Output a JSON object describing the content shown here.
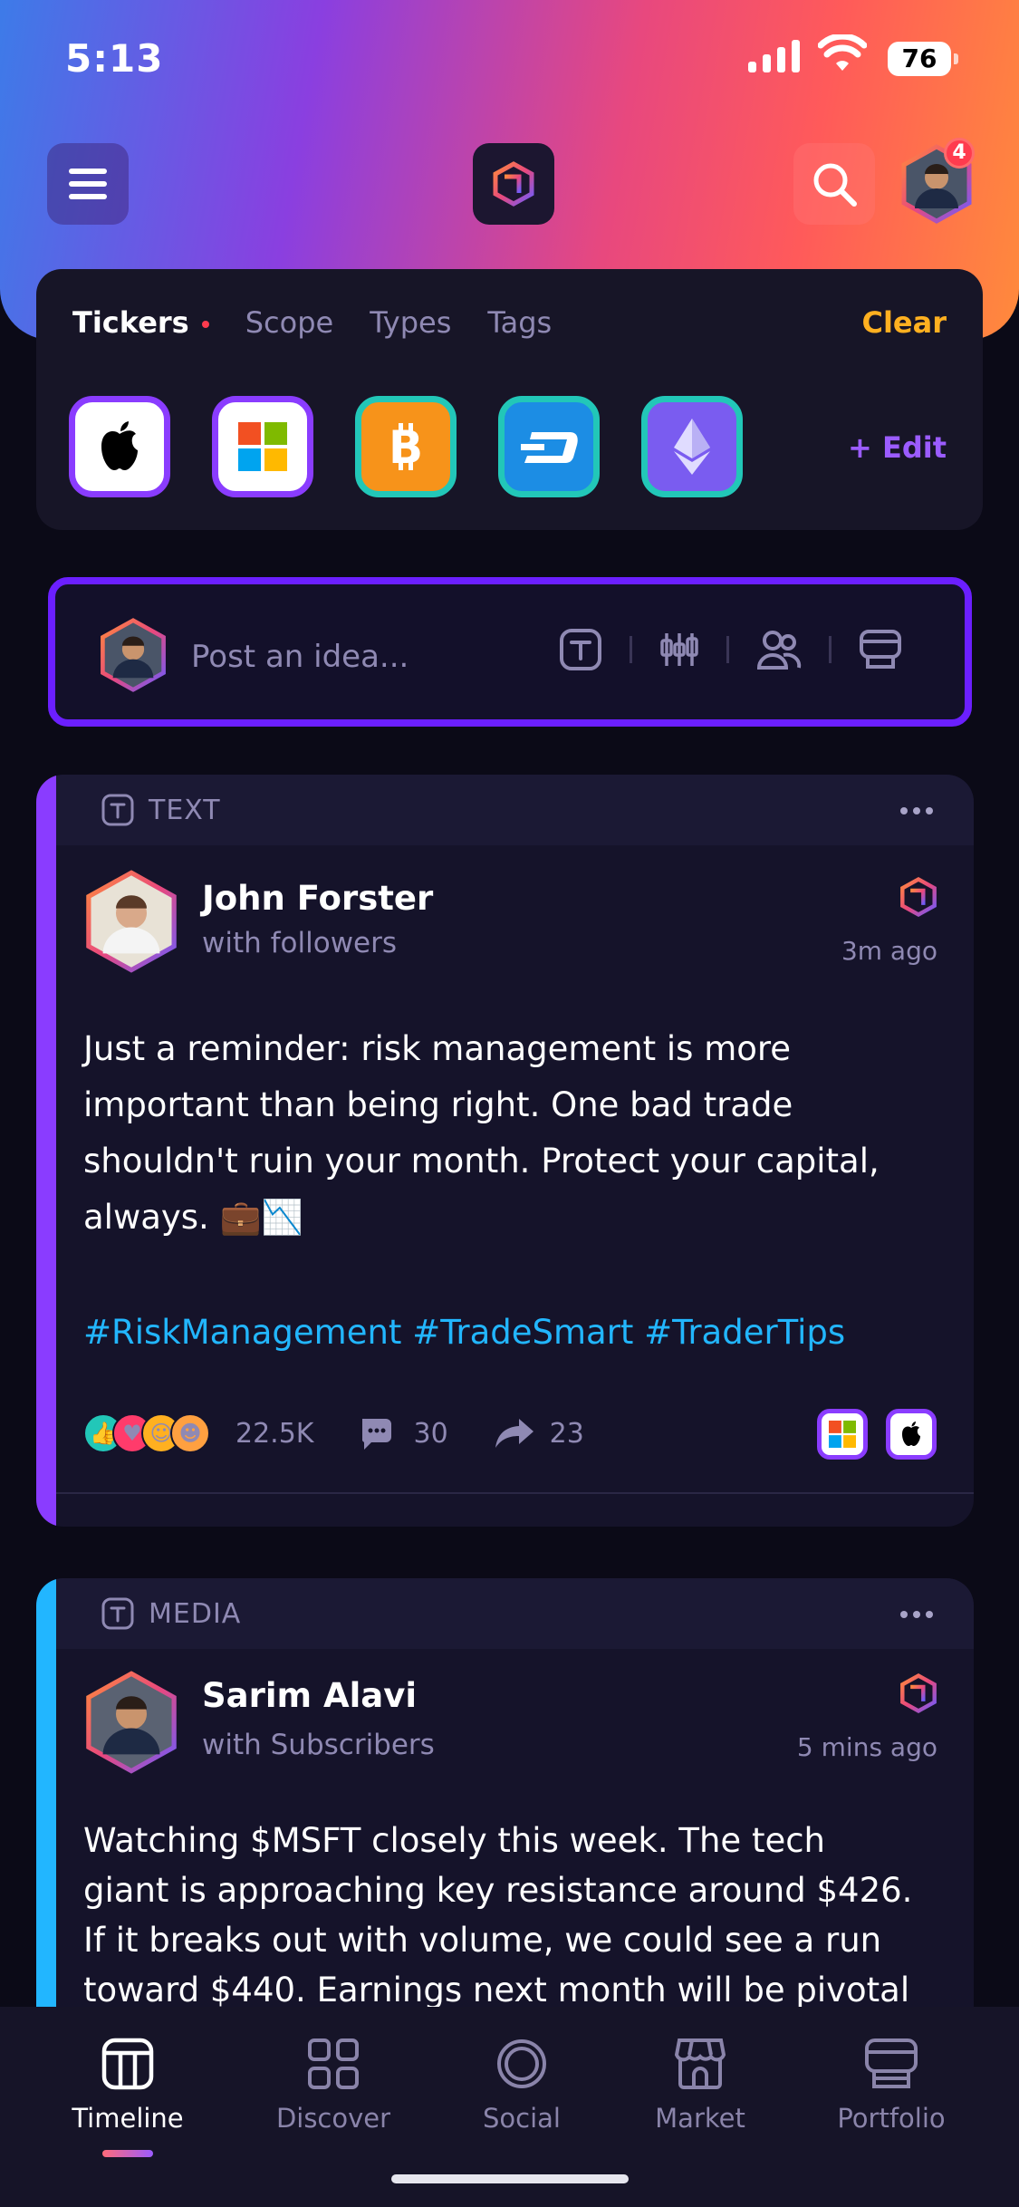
{
  "status_bar": {
    "time": "5:13",
    "battery": "76"
  },
  "header": {
    "notification_count": "4"
  },
  "filters": {
    "tabs": [
      "Tickers",
      "Scope",
      "Types",
      "Tags"
    ],
    "clear_label": "Clear",
    "edit_label": "+ Edit",
    "tickers": [
      {
        "name": "apple-icon",
        "border": "#8a3cff",
        "bg": "#ffffff"
      },
      {
        "name": "microsoft-icon",
        "border": "#8a3cff",
        "bg": "#ffffff"
      },
      {
        "name": "bitcoin-icon",
        "border": "#22c7b8",
        "bg": "#f7931a"
      },
      {
        "name": "dash-icon",
        "border": "#22c7b8",
        "bg": "#1c8de4"
      },
      {
        "name": "ethereum-icon",
        "border": "#22c7b8",
        "bg": "#7a5cf0"
      }
    ]
  },
  "composer": {
    "placeholder": "Post an idea..."
  },
  "posts": [
    {
      "type": "TEXT",
      "stripe": "#8a3cff",
      "author": "John Forster",
      "audience": "with followers",
      "time": "3m ago",
      "text": "Just a reminder: risk management is more important than being right. One bad trade shouldn't ruin your month. Protect your capital, always. 💼📉",
      "hashtags": "#RiskManagement #TradeSmart #TraderTips",
      "likes": "22.5K",
      "comments": "30",
      "shares": "23"
    },
    {
      "type": "MEDIA",
      "stripe": "#22b6ff",
      "author": "Sarim Alavi",
      "audience": "with Subscribers",
      "time": "5 mins ago",
      "text": "Watching $MSFT closely this week. The tech giant is approaching key resistance around $426. If it breaks out with volume, we could see a run toward $440. Earnings next month will be pivotal for"
    }
  ],
  "tab_bar": {
    "tabs": [
      "Timeline",
      "Discover",
      "Social",
      "Market",
      "Portfolio"
    ]
  }
}
